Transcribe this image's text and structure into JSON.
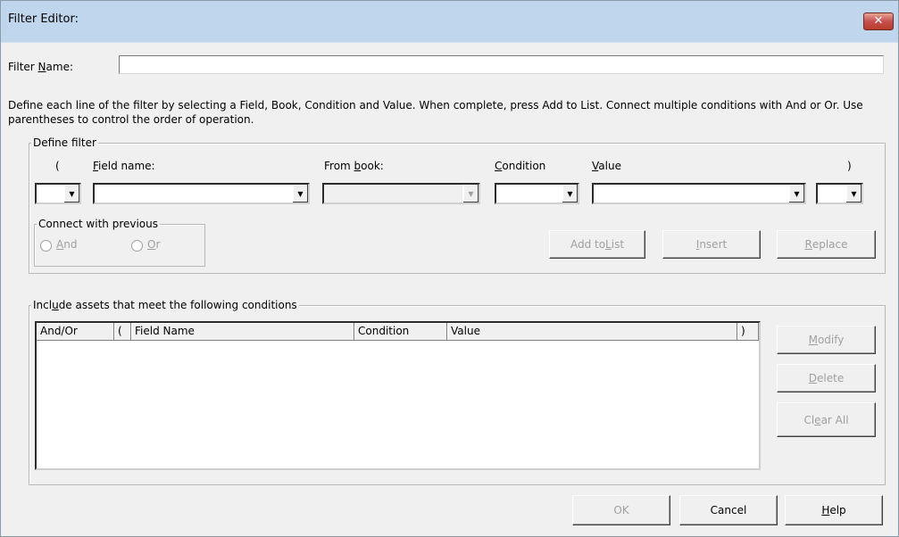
{
  "window": {
    "title": "Filter Editor:",
    "close_glyph": "✕"
  },
  "filter_name": {
    "label": "Filter Name:",
    "value": ""
  },
  "instructions": "Define each line of the filter by selecting a Field, Book, Condition and Value. When complete, press Add to List. Connect multiple conditions with And or Or. Use parentheses to control the order of operation.",
  "define_filter": {
    "group_label": "Define filter",
    "col_open_paren": "(",
    "col_field": "Field name:",
    "col_book": "From book:",
    "col_condition": "Condition",
    "col_value": "Value",
    "col_close_paren": ")",
    "connect_group_label": "Connect with previous",
    "radio_and": "And",
    "radio_or": "Or",
    "add_button": "Add to List",
    "insert_button": "Insert",
    "replace_button": "Replace"
  },
  "conditions": {
    "group_label": "Include assets that meet the following conditions",
    "columns": [
      "And/Or",
      "(",
      "Field Name",
      "Condition",
      "Value",
      ")"
    ],
    "rows": [],
    "modify_button": "Modify",
    "delete_button": "Delete",
    "clear_button": "Clear All"
  },
  "footer": {
    "ok": "OK",
    "cancel": "Cancel",
    "help": "Help"
  },
  "icons": {
    "dropdown": "chevron-down-icon",
    "close": "close-icon"
  }
}
